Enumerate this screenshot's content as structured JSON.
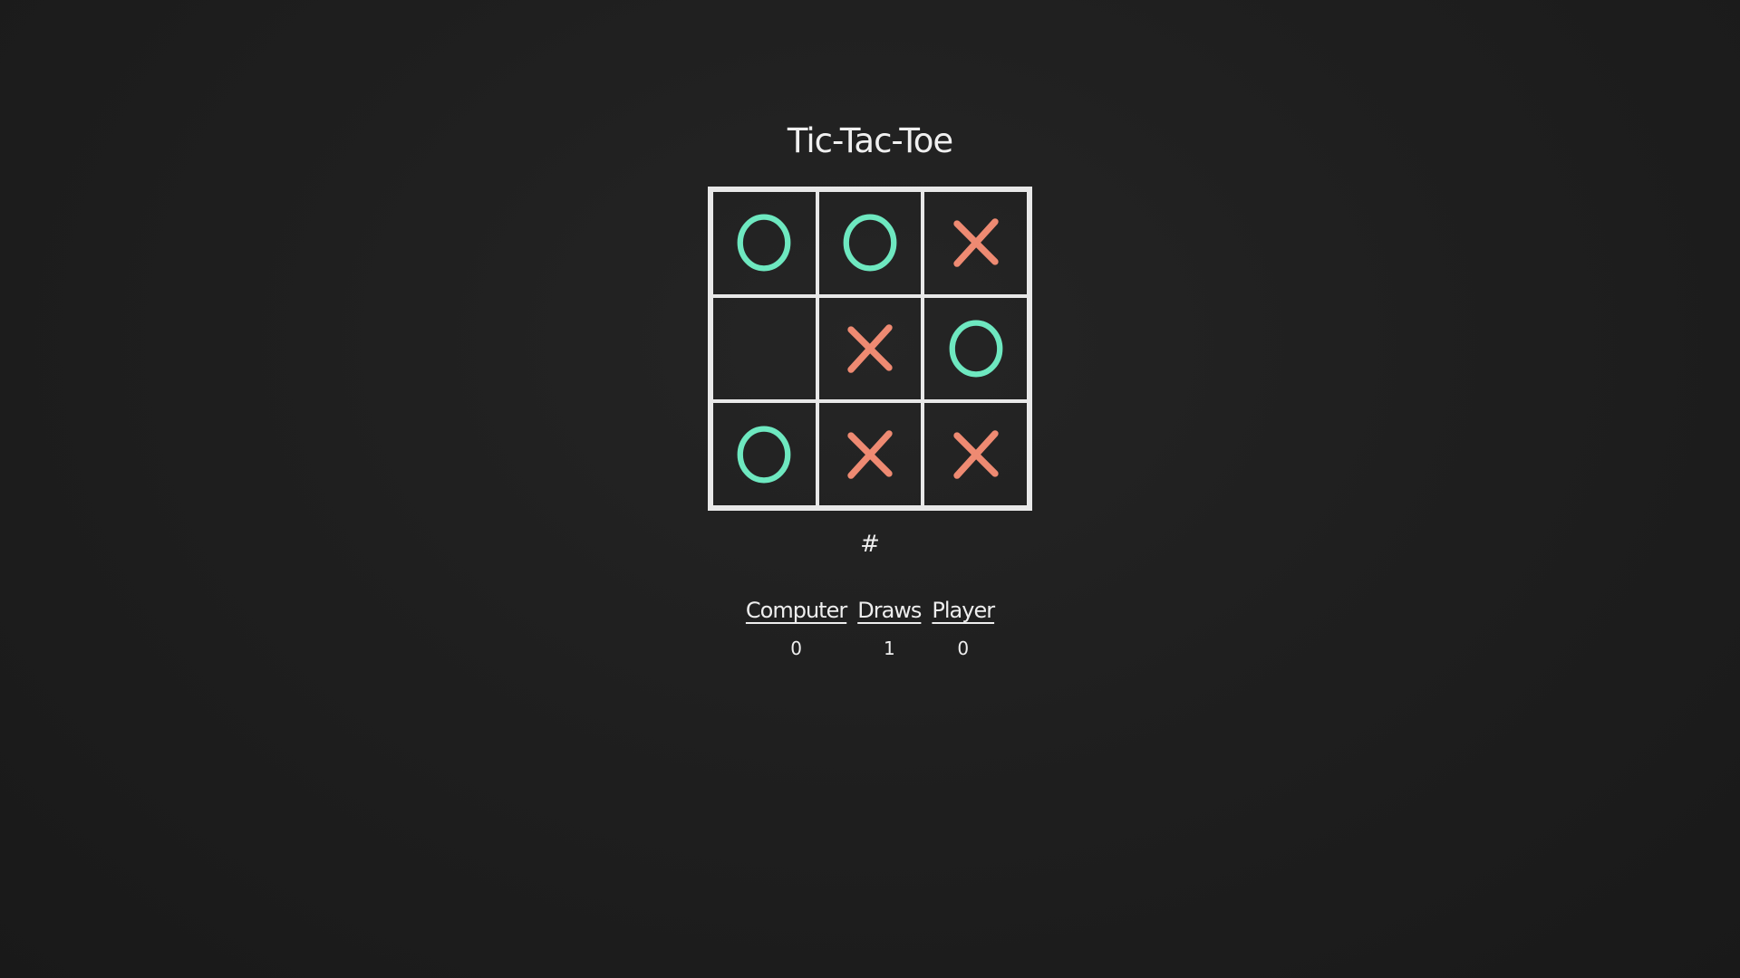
{
  "title": "Tic-Tac-Toe",
  "board": [
    [
      "O",
      "O",
      "X"
    ],
    [
      "",
      "X",
      "O"
    ],
    [
      "O",
      "X",
      "X"
    ]
  ],
  "turn_indicator": "#",
  "scores": [
    {
      "label": "Computer",
      "value": "0"
    },
    {
      "label": "Draws",
      "value": "1"
    },
    {
      "label": "Player",
      "value": "0"
    }
  ],
  "colors": {
    "o_mark": "#6ee8c0",
    "x_mark": "#ee8a72",
    "grid": "#e8e8e8"
  }
}
